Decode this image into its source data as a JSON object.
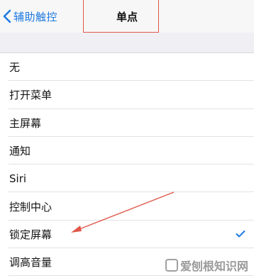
{
  "navbar": {
    "back_label": "辅助触控",
    "title": "单点"
  },
  "list": {
    "items": [
      {
        "label": "无",
        "selected": false
      },
      {
        "label": "打开菜单",
        "selected": false
      },
      {
        "label": "主屏幕",
        "selected": false
      },
      {
        "label": "通知",
        "selected": false
      },
      {
        "label": "Siri",
        "selected": false
      },
      {
        "label": "控制中心",
        "selected": false
      },
      {
        "label": "锁定屏幕",
        "selected": true
      },
      {
        "label": "调高音量",
        "selected": false
      }
    ]
  },
  "watermark": {
    "text": "爱刨根知识网"
  },
  "colors": {
    "accent": "#1f7ae0",
    "annotation_red": "#e0584a"
  },
  "icons": {
    "back": "chevron-left-icon",
    "check": "checkmark-icon"
  }
}
